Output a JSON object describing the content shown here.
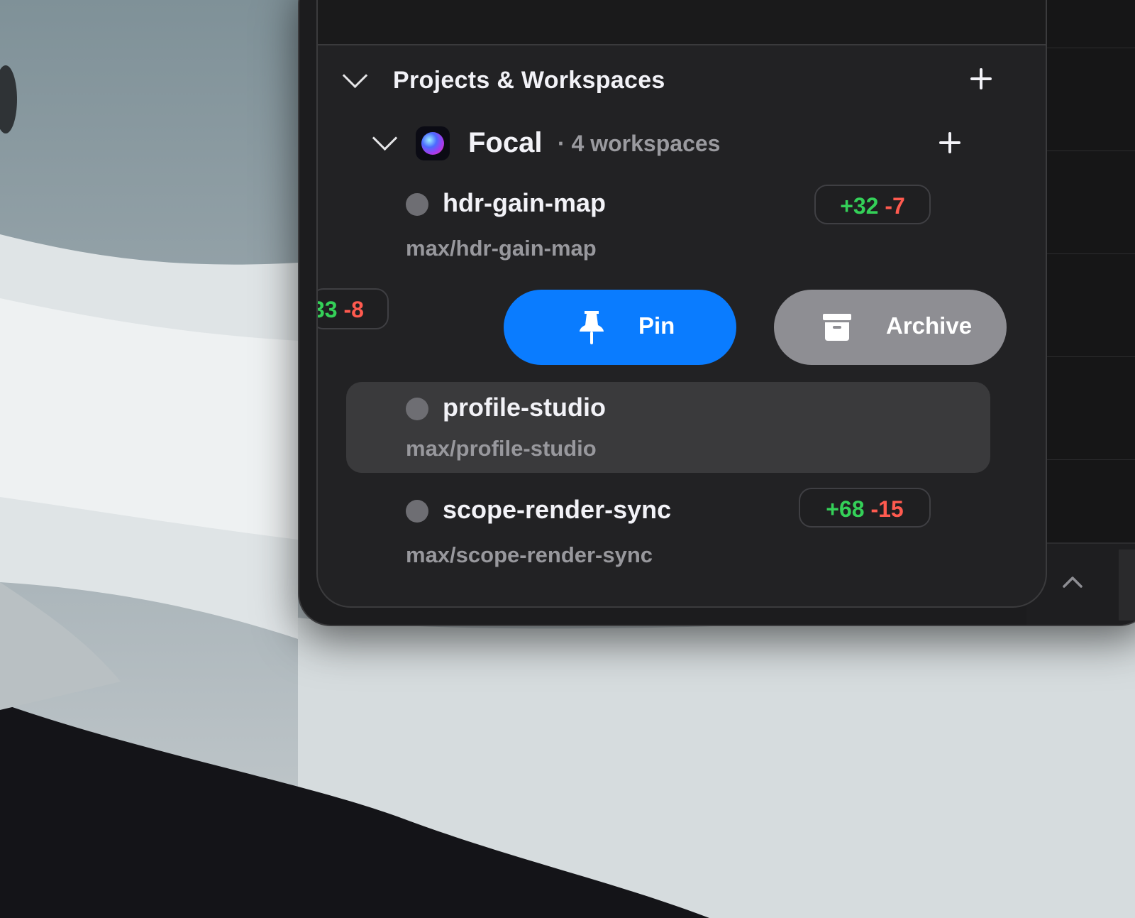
{
  "sidebar": {
    "section_title": "Projects & Workspaces",
    "project": {
      "name": "Focal",
      "meta": "· 4 workspaces"
    },
    "workspaces": [
      {
        "name": "hdr-gain-map",
        "branch": "max/hdr-gain-map",
        "additions": "+32",
        "deletions": "-7"
      },
      {
        "name": "profile-studio",
        "branch": "max/profile-studio"
      },
      {
        "name": "scope-render-sync",
        "branch": "max/scope-render-sync",
        "additions": "+68",
        "deletions": "-15"
      }
    ],
    "swiped_row_badge": {
      "additions": "33",
      "deletions": "-8"
    },
    "actions": {
      "pin_label": "Pin",
      "archive_label": "Archive"
    }
  },
  "colors": {
    "accent_blue": "#0a7cff",
    "archive_gray": "#8e8e93",
    "addition_green": "#34d058",
    "deletion_red": "#ff5a4f"
  },
  "icons": [
    "chevron-down-icon",
    "plus-icon",
    "pin-icon",
    "archive-box-icon",
    "chevron-up-icon"
  ]
}
